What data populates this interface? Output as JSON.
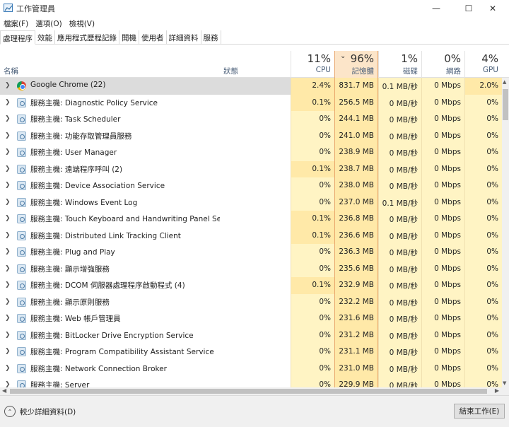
{
  "window": {
    "title": "工作管理員"
  },
  "menu": [
    "檔案(F)",
    "選項(O)",
    "檢視(V)"
  ],
  "tabs": [
    "處理程序",
    "效能",
    "應用程式歷程記錄",
    "開機",
    "使用者",
    "詳細資料",
    "服務"
  ],
  "columns": {
    "name": "名稱",
    "status": "狀態",
    "cpu": {
      "percent": "11%",
      "label": "CPU"
    },
    "memory": {
      "percent": "96%",
      "label": "記憶體"
    },
    "disk": {
      "percent": "1%",
      "label": "磁碟"
    },
    "network": {
      "percent": "0%",
      "label": "網路"
    },
    "gpu": {
      "percent": "4%",
      "label": "GPU"
    }
  },
  "processes": [
    {
      "name": "Google Chrome (22)",
      "icon": "chrome-icon",
      "cpu": "2.4%",
      "memory": "831.7 MB",
      "disk": "0.1 MB/秒",
      "network": "0 Mbps",
      "gpu": "2.0%",
      "selected": true
    },
    {
      "name": "服務主機: Diagnostic Policy Service",
      "icon": "service-gear-icon",
      "cpu": "0.1%",
      "memory": "256.5 MB",
      "disk": "0 MB/秒",
      "network": "0 Mbps",
      "gpu": "0%"
    },
    {
      "name": "服務主機: Task Scheduler",
      "icon": "service-gear-icon",
      "cpu": "0%",
      "memory": "244.1 MB",
      "disk": "0 MB/秒",
      "network": "0 Mbps",
      "gpu": "0%"
    },
    {
      "name": "服務主機: 功能存取管理員服務",
      "icon": "service-gear-icon",
      "cpu": "0%",
      "memory": "241.0 MB",
      "disk": "0 MB/秒",
      "network": "0 Mbps",
      "gpu": "0%"
    },
    {
      "name": "服務主機: User Manager",
      "icon": "service-gear-icon",
      "cpu": "0%",
      "memory": "238.9 MB",
      "disk": "0 MB/秒",
      "network": "0 Mbps",
      "gpu": "0%"
    },
    {
      "name": "服務主機: 遠端程序呼叫 (2)",
      "icon": "service-gear-icon",
      "cpu": "0.1%",
      "memory": "238.7 MB",
      "disk": "0 MB/秒",
      "network": "0 Mbps",
      "gpu": "0%"
    },
    {
      "name": "服務主機: Device Association Service",
      "icon": "service-gear-icon",
      "cpu": "0%",
      "memory": "238.0 MB",
      "disk": "0 MB/秒",
      "network": "0 Mbps",
      "gpu": "0%"
    },
    {
      "name": "服務主機: Windows Event Log",
      "icon": "service-gear-icon",
      "cpu": "0%",
      "memory": "237.0 MB",
      "disk": "0.1 MB/秒",
      "network": "0 Mbps",
      "gpu": "0%"
    },
    {
      "name": "服務主機: Touch Keyboard and Handwriting Panel Servi...",
      "icon": "service-gear-icon",
      "cpu": "0.1%",
      "memory": "236.8 MB",
      "disk": "0 MB/秒",
      "network": "0 Mbps",
      "gpu": "0%"
    },
    {
      "name": "服務主機: Distributed Link Tracking Client",
      "icon": "service-gear-icon",
      "cpu": "0.1%",
      "memory": "236.6 MB",
      "disk": "0 MB/秒",
      "network": "0 Mbps",
      "gpu": "0%"
    },
    {
      "name": "服務主機: Plug and Play",
      "icon": "service-gear-icon",
      "cpu": "0%",
      "memory": "236.3 MB",
      "disk": "0 MB/秒",
      "network": "0 Mbps",
      "gpu": "0%"
    },
    {
      "name": "服務主機: 顯示增強服務",
      "icon": "service-gear-icon",
      "cpu": "0%",
      "memory": "235.6 MB",
      "disk": "0 MB/秒",
      "network": "0 Mbps",
      "gpu": "0%"
    },
    {
      "name": "服務主機: DCOM 伺服器處理程序啟動程式 (4)",
      "icon": "service-gear-icon",
      "cpu": "0.1%",
      "memory": "232.9 MB",
      "disk": "0 MB/秒",
      "network": "0 Mbps",
      "gpu": "0%"
    },
    {
      "name": "服務主機: 顯示原則服務",
      "icon": "service-gear-icon",
      "cpu": "0%",
      "memory": "232.2 MB",
      "disk": "0 MB/秒",
      "network": "0 Mbps",
      "gpu": "0%"
    },
    {
      "name": "服務主機: Web 帳戶管理員",
      "icon": "service-gear-icon",
      "cpu": "0%",
      "memory": "231.6 MB",
      "disk": "0 MB/秒",
      "network": "0 Mbps",
      "gpu": "0%"
    },
    {
      "name": "服務主機: BitLocker Drive Encryption Service",
      "icon": "service-gear-icon",
      "cpu": "0%",
      "memory": "231.2 MB",
      "disk": "0 MB/秒",
      "network": "0 Mbps",
      "gpu": "0%"
    },
    {
      "name": "服務主機: Program Compatibility Assistant Service",
      "icon": "service-gear-icon",
      "cpu": "0%",
      "memory": "231.1 MB",
      "disk": "0 MB/秒",
      "network": "0 Mbps",
      "gpu": "0%"
    },
    {
      "name": "服務主機: Network Connection Broker",
      "icon": "service-gear-icon",
      "cpu": "0%",
      "memory": "231.0 MB",
      "disk": "0 MB/秒",
      "network": "0 Mbps",
      "gpu": "0%"
    },
    {
      "name": "服務主機: Server",
      "icon": "service-gear-icon",
      "cpu": "0%",
      "memory": "229.9 MB",
      "disk": "0 MB/秒",
      "network": "0 Mbps",
      "gpu": "0%"
    }
  ],
  "footer": {
    "fewer_details": "較少詳細資料(D)",
    "end_task": "結束工作(E)"
  }
}
